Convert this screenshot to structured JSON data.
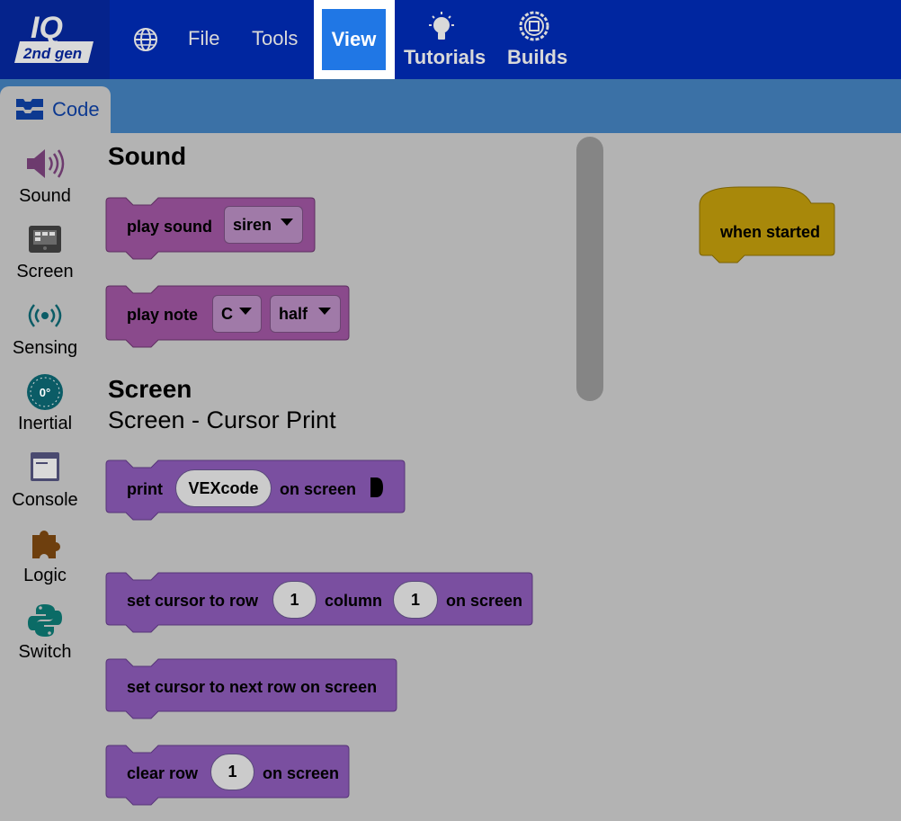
{
  "menu": {
    "logo_top": "IQ",
    "logo_bottom": "2nd gen",
    "file": "File",
    "tools": "Tools",
    "view": "View",
    "tutorials": "Tutorials",
    "builds": "Builds"
  },
  "tab": {
    "code": "Code"
  },
  "categories": [
    "Sound",
    "Screen",
    "Sensing",
    "Inertial",
    "Console",
    "Logic",
    "Switch"
  ],
  "inertial_icon_text": "0°",
  "flyout": {
    "sound_heading": "Sound",
    "screen_heading": "Screen",
    "screen_subheading": "Screen - Cursor Print",
    "play_sound": {
      "label": "play sound",
      "value": "siren"
    },
    "play_note": {
      "label": "play note",
      "note": "C",
      "duration": "half"
    },
    "print": {
      "label": "print",
      "value": "VEXcode",
      "suffix": "on screen"
    },
    "set_cursor": {
      "label": "set cursor to row",
      "row": "1",
      "column_label": "column",
      "column": "1",
      "suffix": "on screen"
    },
    "next_row": {
      "label": "set cursor to next row on screen"
    },
    "clear_row": {
      "label": "clear row",
      "value": "1",
      "suffix": "on screen"
    }
  },
  "workspace": {
    "hat": "when started"
  },
  "colors": {
    "topbar": "#0026a0",
    "view_active": "#2077e5",
    "subbar": "#3b71a6",
    "sound_block": "#8a4a8c",
    "screen_block": "#7a4fa0",
    "event_block": "#a8880a"
  }
}
